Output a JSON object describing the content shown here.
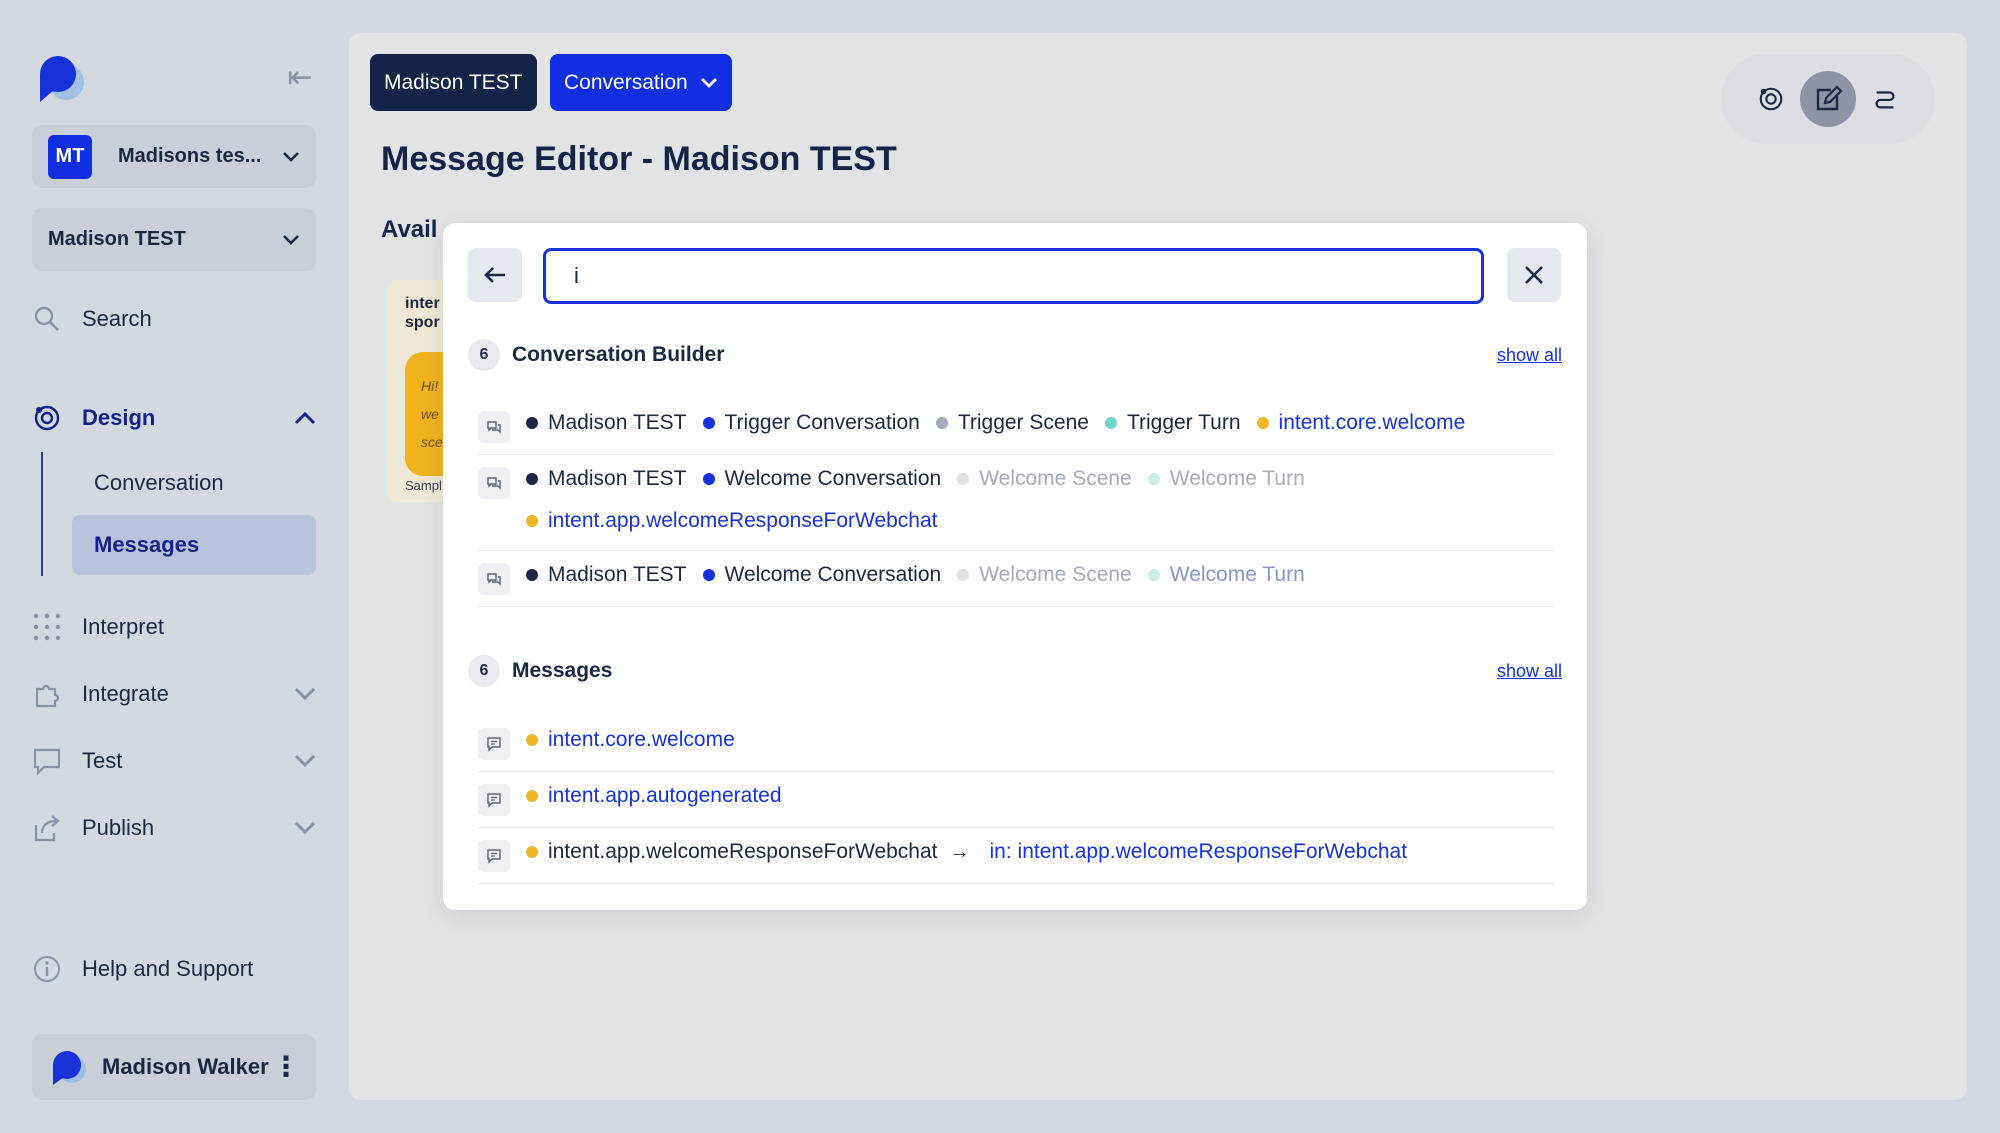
{
  "sidebar": {
    "workspace": {
      "initials": "MT",
      "name": "Madisons tes..."
    },
    "project": {
      "name": "Madison TEST"
    },
    "search_label": "Search",
    "design": {
      "label": "Design",
      "items": [
        "Conversation",
        "Messages"
      ],
      "active": "Messages"
    },
    "interpret_label": "Interpret",
    "integrate_label": "Integrate",
    "test_label": "Test",
    "publish_label": "Publish",
    "help_label": "Help and Support",
    "user_name": "Madison Walker"
  },
  "header": {
    "crumb_project": "Madison TEST",
    "crumb_section": "Conversation",
    "title": "Message Editor - Madison TEST",
    "available_label": "Avail"
  },
  "card_peek": {
    "title_line1": "inter",
    "title_line2": "spor",
    "text_lines": [
      "Hi!",
      "we",
      "sce"
    ],
    "footer": "Sampl"
  },
  "search": {
    "query": "i",
    "conversation_builder": {
      "count": "6",
      "title": "Conversation Builder",
      "show_all": "show all",
      "results": [
        {
          "tokens": [
            {
              "text": "Madison TEST",
              "color": "#1c2740",
              "dot": "#1c2740"
            },
            {
              "text": "Trigger Conversation",
              "color": "#1c2740",
              "dot": "#1632d8"
            },
            {
              "text": "Trigger Scene",
              "color": "#1c2740",
              "dot": "#a7acbc"
            },
            {
              "text": "Trigger Turn",
              "color": "#1c2740",
              "dot": "#6fd3c8"
            },
            {
              "text": "intent.core.welcome",
              "color": "#1632d8",
              "dot": "#f0b429"
            }
          ]
        },
        {
          "tokens": [
            {
              "text": "Madison TEST",
              "color": "#1c2740",
              "dot": "#1c2740"
            },
            {
              "text": "Welcome Conversation",
              "color": "#1c2740",
              "dot": "#1632d8"
            },
            {
              "text": "Welcome Scene",
              "color": "#a7acbc",
              "dot": "#dfe1e7"
            },
            {
              "text": "Welcome Turn",
              "color": "#a7acbc",
              "dot": "#cdeee9"
            }
          ],
          "tokens2": [
            {
              "text": "intent.app.welcomeResponseForWebchat",
              "color": "#1632d8",
              "dot": "#f0b429"
            }
          ]
        },
        {
          "tokens": [
            {
              "text": "Madison TEST",
              "color": "#1c2740",
              "dot": "#1c2740"
            },
            {
              "text": "Welcome Conversation",
              "color": "#1c2740",
              "dot": "#1632d8"
            },
            {
              "text": "Welcome Scene",
              "color": "#a7acbc",
              "dot": "#dfe1e7"
            },
            {
              "text": "Welcome Turn",
              "color": "#8a95c8",
              "dot": "#cdeee9"
            }
          ]
        }
      ]
    },
    "messages": {
      "count": "6",
      "title": "Messages",
      "show_all": "show all",
      "results": [
        {
          "text": "intent.core.welcome",
          "color": "#1632d8"
        },
        {
          "text": "intent.app.autogenerated",
          "color": "#1632d8"
        },
        {
          "text": "intent.app.welcomeResponseForWebchat",
          "color": "#1c2740",
          "in_label": "in:",
          "in_value": "intent.app.welcomeResponseForWebchat"
        }
      ]
    }
  }
}
